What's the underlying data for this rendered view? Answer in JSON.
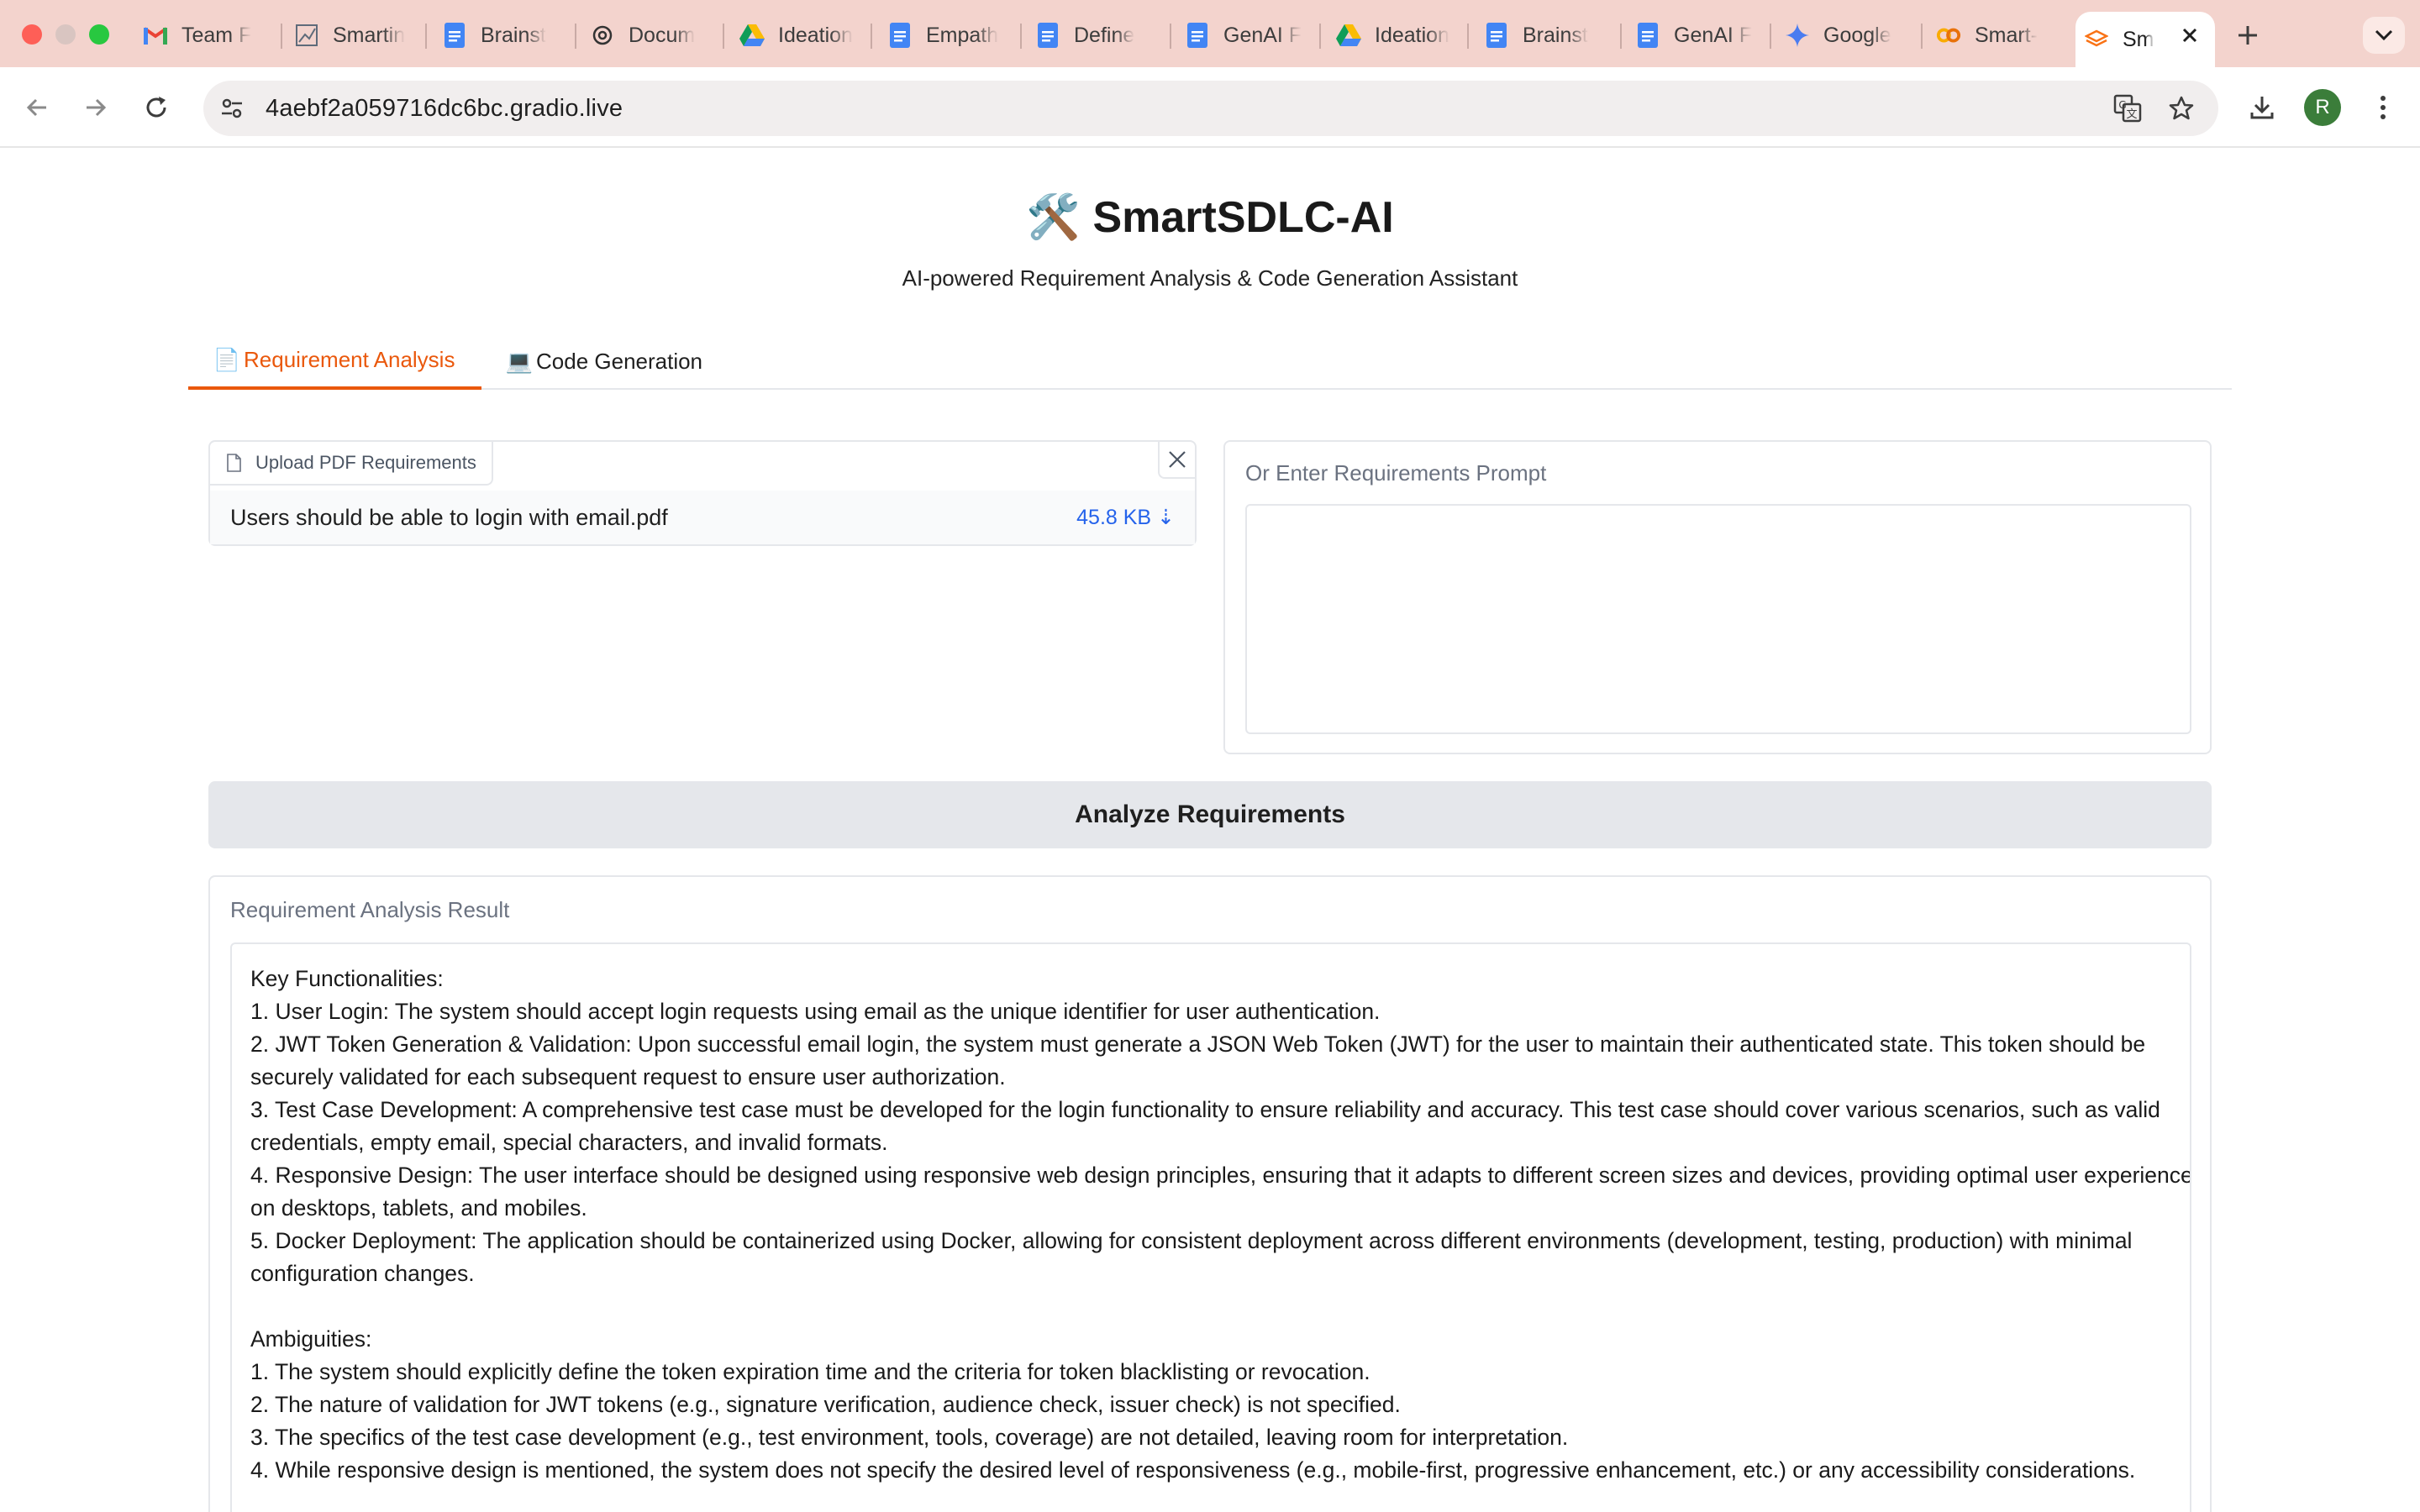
{
  "browser": {
    "tabs": [
      {
        "icon": "gmail-icon",
        "label": "Team F"
      },
      {
        "icon": "chart-doc-icon",
        "label": "Smartin"
      },
      {
        "icon": "google-docs-icon",
        "label": "Brainst"
      },
      {
        "icon": "openai-icon",
        "label": "Docum"
      },
      {
        "icon": "google-drive-icon",
        "label": "Ideation"
      },
      {
        "icon": "google-docs-icon",
        "label": "Empath"
      },
      {
        "icon": "google-docs-icon",
        "label": "Define"
      },
      {
        "icon": "google-docs-icon",
        "label": "GenAI F"
      },
      {
        "icon": "google-drive-icon",
        "label": "Ideation"
      },
      {
        "icon": "google-docs-icon",
        "label": "Brainst"
      },
      {
        "icon": "google-docs-icon",
        "label": "GenAI F"
      },
      {
        "icon": "gemini-icon",
        "label": "Google"
      },
      {
        "icon": "colab-icon",
        "label": "Smart-"
      },
      {
        "icon": "gradio-icon",
        "label": "Sm"
      }
    ],
    "url": "4aebf2a059716dc6bc.gradio.live",
    "profile_initial": "R"
  },
  "app": {
    "title": "🛠️ SmartSDLC-AI",
    "subtitle": "AI-powered Requirement Analysis & Code Generation Assistant",
    "tabs": [
      {
        "icon": "📄",
        "label": "Requirement Analysis"
      },
      {
        "icon": "💻",
        "label": "Code Generation"
      }
    ]
  },
  "upload": {
    "label": "Upload PDF Requirements",
    "file_name": "Users should be able to login with email.pdf",
    "file_size": "45.8 KB ⇣"
  },
  "prompt": {
    "label": "Or Enter Requirements Prompt",
    "value": ""
  },
  "analyze_button": "Analyze Requirements",
  "result": {
    "label": "Requirement Analysis Result",
    "lines": [
      "Key Functionalities:",
      "1. User Login: The system should accept login requests using email as the unique identifier for user authentication.",
      "2. JWT Token Generation & Validation: Upon successful email login, the system must generate a JSON Web Token (JWT) for the user to maintain their authenticated state. This token should be",
      "securely validated for each subsequent request to ensure user authorization.",
      "3. Test Case Development: A comprehensive test case must be developed for the login functionality to ensure reliability and accuracy. This test case should cover various scenarios, such as valid",
      "credentials, empty email, special characters, and invalid formats.",
      "4. Responsive Design: The user interface should be designed using responsive web design principles, ensuring that it adapts to different screen sizes and devices, providing optimal user experience",
      "on desktops, tablets, and mobiles.",
      "5. Docker Deployment: The application should be containerized using Docker, allowing for consistent deployment across different environments (development, testing, production) with minimal",
      "configuration changes.",
      "",
      "Ambiguities:",
      "1. The system should explicitly define the token expiration time and the criteria for token blacklisting or revocation.",
      "2. The nature of validation for JWT tokens (e.g., signature verification, audience check, issuer check) is not specified.",
      "3. The specifics of the test case development (e.g., test environment, tools, coverage) are not detailed, leaving room for interpretation.",
      "4. While responsive design is mentioned, the system does not specify the desired level of responsiveness (e.g., mobile-first, progressive enhancement, etc.) or any accessibility considerations."
    ]
  },
  "colors": {
    "tabstrip_bg": "#f3d3cd",
    "accent": "#ea580c",
    "link": "#2563eb",
    "button_bg": "#e5e7eb"
  }
}
